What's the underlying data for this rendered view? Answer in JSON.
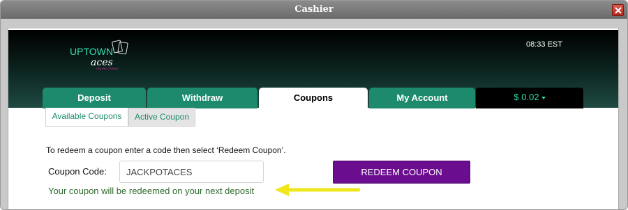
{
  "window": {
    "title": "Cashier"
  },
  "header": {
    "logo": {
      "line1": "UPTOWN",
      "line2": "aces",
      "line3": "ONLINE CASINO"
    },
    "clock": "08:33 EST"
  },
  "tabs": [
    {
      "label": "Deposit",
      "active": false
    },
    {
      "label": "Withdraw",
      "active": false
    },
    {
      "label": "Coupons",
      "active": true
    },
    {
      "label": "My Account",
      "active": false
    }
  ],
  "balance": {
    "label": "$ 0.02"
  },
  "subtabs": [
    {
      "label": "Available Coupons"
    },
    {
      "label": "Active Coupon"
    }
  ],
  "coupon_form": {
    "instructions": "To redeem a coupon enter a code then select ‘Redeem Coupon’.",
    "code_label": "Coupon Code:",
    "code_value": "JACKPOTACES",
    "redeem_label": "REDEEM COUPON",
    "message": "Your coupon will be redeemed on your next deposit"
  },
  "colors": {
    "tab_green": "#1e8a6d",
    "button_purple": "#6a0d8f",
    "arrow_yellow": "#f0e61c",
    "message_green": "#2f6b2f",
    "balance_teal": "#2fd6a9"
  }
}
